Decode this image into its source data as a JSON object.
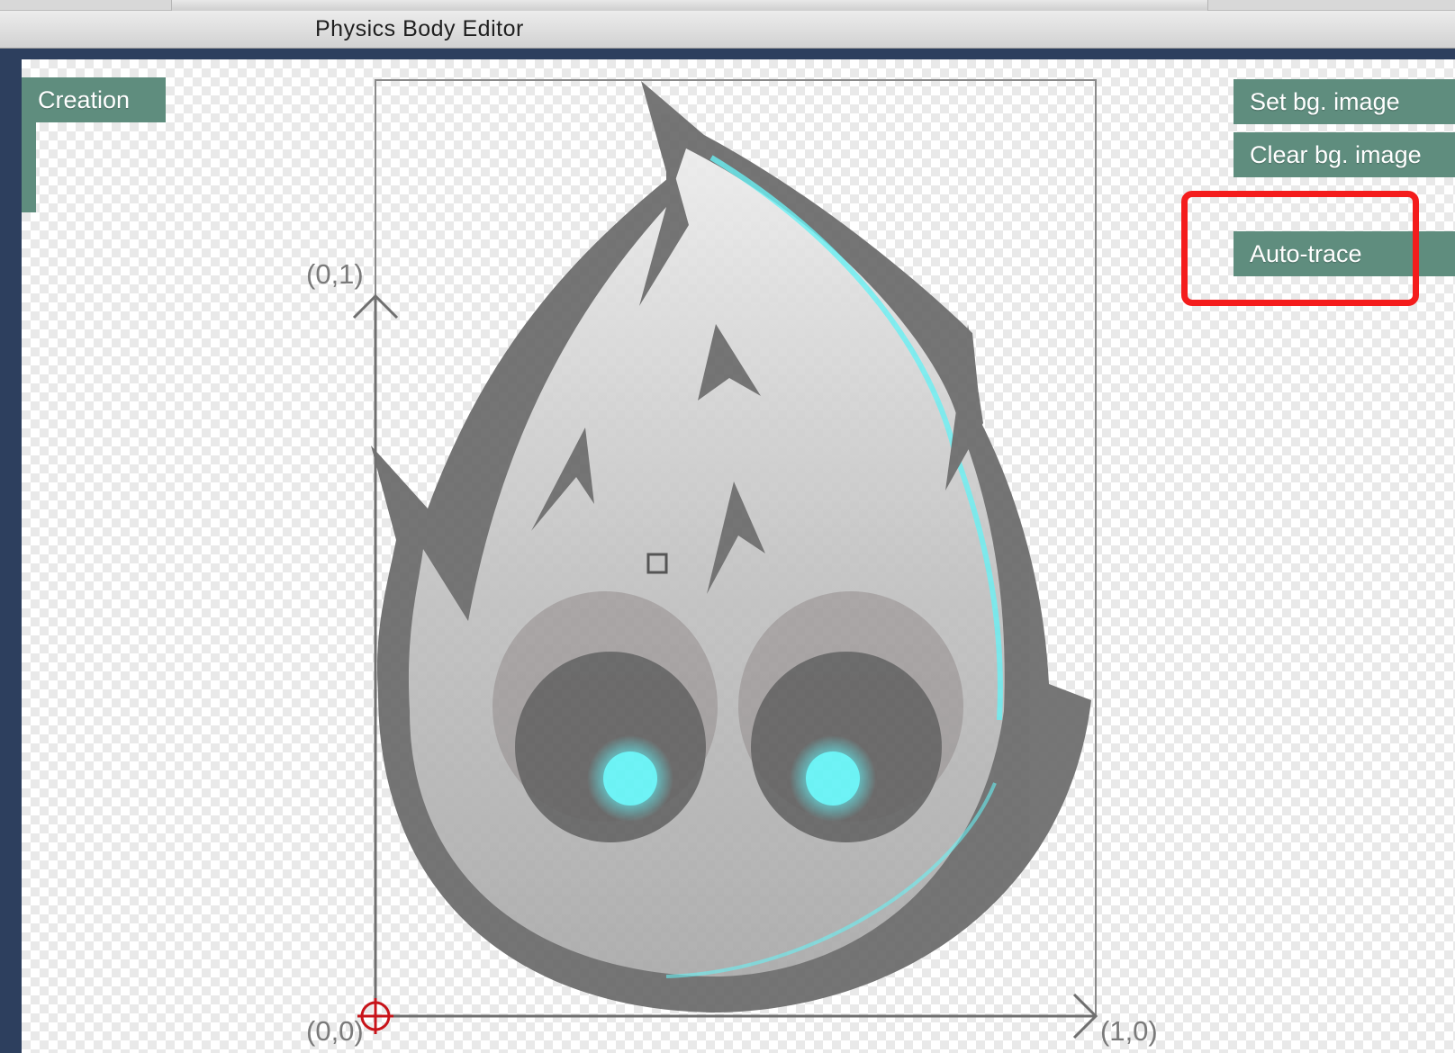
{
  "window": {
    "title": "Physics Body Editor"
  },
  "panels": {
    "creation_label": "Creation"
  },
  "toolbar": {
    "set_bg_label": "Set bg. image",
    "clear_bg_label": "Clear bg. image",
    "auto_trace_label": "Auto-trace"
  },
  "axes": {
    "y_label": "(0,1)",
    "origin_label": "(0,0)",
    "x_label": "(1,0)"
  },
  "colors": {
    "panel_button": "#5f8d7e",
    "highlight": "#f41c1c",
    "eye_glow": "#5ef0f4",
    "frame_background": "#2d3f5e"
  },
  "icons": {
    "origin_marker": "crosshair-icon",
    "center_marker": "square-handle-icon",
    "sprite": "cocos-mascot-sprite"
  }
}
